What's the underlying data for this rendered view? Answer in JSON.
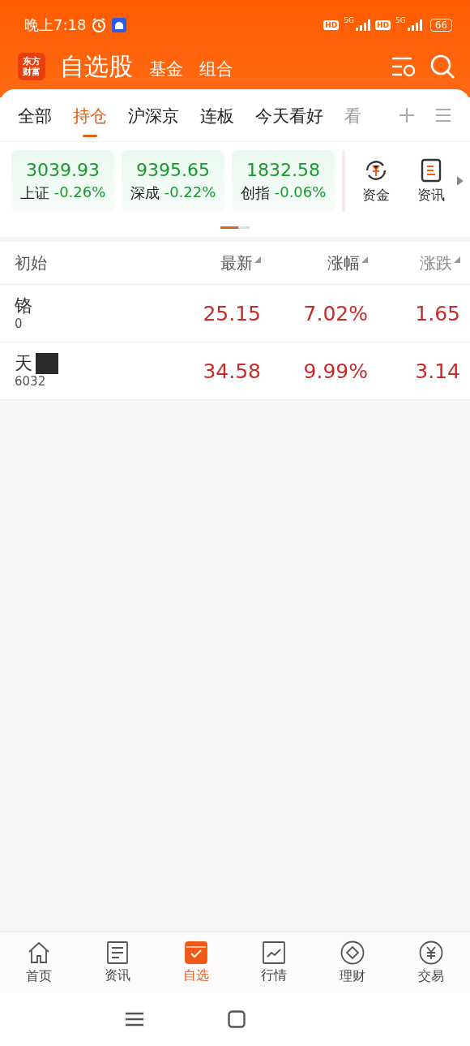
{
  "status_bar": {
    "time": "晚上7:18",
    "hd_1": "HD",
    "hd_2": "HD",
    "network_1": "5G",
    "network_2": "5G",
    "battery": "66"
  },
  "header": {
    "logo": [
      "东方",
      "财富"
    ],
    "title": "自选股",
    "links": [
      "基金",
      "组合"
    ]
  },
  "tabs": [
    {
      "label": "全部",
      "selected": false
    },
    {
      "label": "持仓",
      "selected": true
    },
    {
      "label": "沪深京",
      "selected": false
    },
    {
      "label": "连板",
      "selected": false
    },
    {
      "label": "今天看好",
      "selected": false
    },
    {
      "label": "看",
      "selected": false
    }
  ],
  "indices": [
    {
      "value": "3039.93",
      "name": "上证",
      "change": "-0.26%"
    },
    {
      "value": "9395.65",
      "name": "深成",
      "change": "-0.22%"
    },
    {
      "value": "1832.58",
      "name": "创指",
      "change": "-0.06%"
    }
  ],
  "shortcuts": [
    {
      "label": "资金",
      "kind": "money"
    },
    {
      "label": "资讯",
      "kind": "news"
    }
  ],
  "table": {
    "columns": [
      "初始",
      "最新",
      "涨幅",
      "涨跌"
    ],
    "rows": [
      {
        "name": "铬",
        "code": "0",
        "latest": "25.15",
        "change_pct": "7.02%",
        "change": "1.65"
      },
      {
        "name": "天",
        "code": "6032",
        "redacted": true,
        "latest": "34.58",
        "change_pct": "9.99%",
        "change": "3.14"
      }
    ]
  },
  "bottom_nav": [
    {
      "label": "首页",
      "kind": "home",
      "selected": false
    },
    {
      "label": "资讯",
      "kind": "news",
      "selected": false
    },
    {
      "label": "自选",
      "kind": "watch",
      "selected": true
    },
    {
      "label": "行情",
      "kind": "chart",
      "selected": false
    },
    {
      "label": "理财",
      "kind": "diamond",
      "selected": false
    },
    {
      "label": "交易",
      "kind": "yuan",
      "selected": false
    }
  ]
}
